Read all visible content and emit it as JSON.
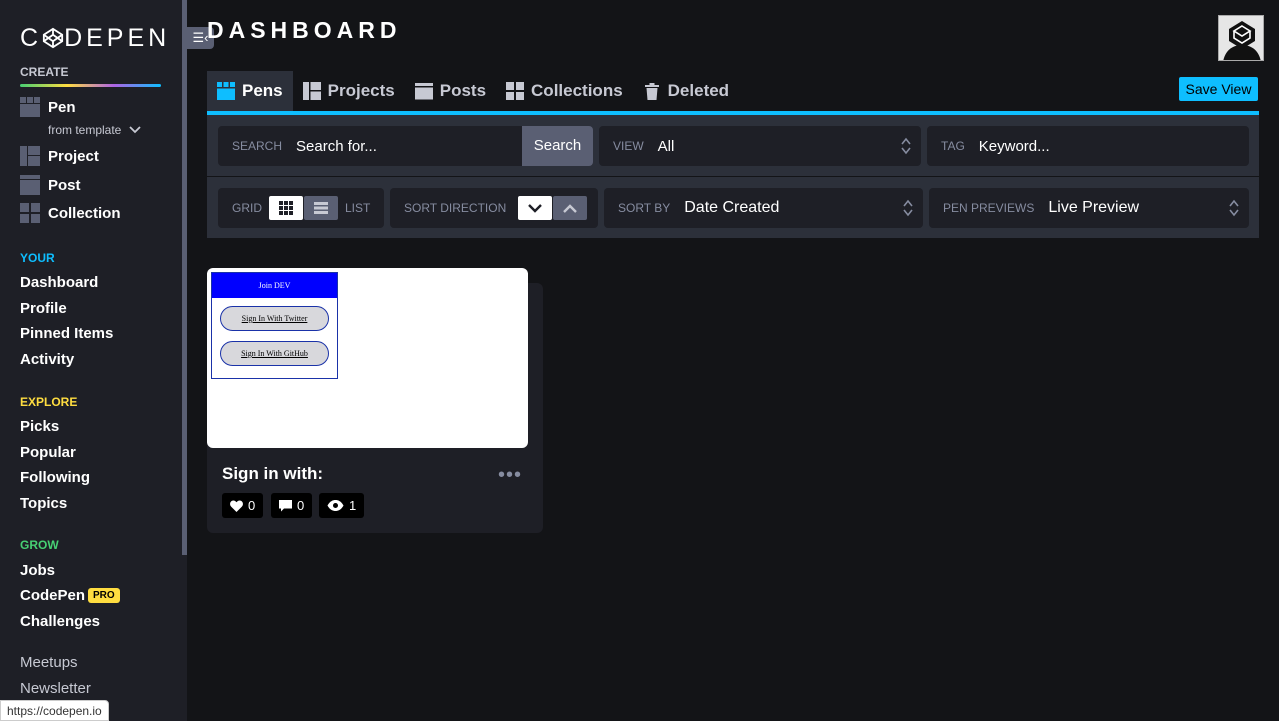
{
  "sidebar": {
    "logo_text": "CODEPEN",
    "create_label": "CREATE",
    "create_items": [
      {
        "label": "Pen",
        "icon": "pen-icon"
      },
      {
        "label": "Project",
        "icon": "project-icon"
      },
      {
        "label": "Post",
        "icon": "post-icon"
      },
      {
        "label": "Collection",
        "icon": "collection-icon"
      }
    ],
    "from_template": "from template",
    "your_label": "YOUR",
    "your_items": [
      "Dashboard",
      "Profile",
      "Pinned Items",
      "Activity"
    ],
    "explore_label": "EXPLORE",
    "explore_items": [
      "Picks",
      "Popular",
      "Following",
      "Topics"
    ],
    "grow_label": "GROW",
    "grow_items": [
      "Jobs",
      "CodePen",
      "Challenges"
    ],
    "pro_badge": "PRO",
    "extra_items": [
      "Meetups",
      "Newsletter"
    ],
    "colors": {
      "your": "#0ebeff",
      "explore": "#ffdd40",
      "grow": "#47cf73"
    }
  },
  "status_url": "https://codepen.io",
  "header": {
    "title": "DASHBOARD",
    "save_view": "Save View"
  },
  "tabs": [
    {
      "label": "Pens",
      "icon": "pens-icon",
      "active": true
    },
    {
      "label": "Projects",
      "icon": "projects-icon"
    },
    {
      "label": "Posts",
      "icon": "posts-icon"
    },
    {
      "label": "Collections",
      "icon": "collections-icon"
    },
    {
      "label": "Deleted",
      "icon": "trash-icon"
    }
  ],
  "filters": {
    "search_label": "SEARCH",
    "search_placeholder": "Search for...",
    "search_button": "Search",
    "view_label": "VIEW",
    "view_value": "All",
    "tag_label": "TAG",
    "tag_placeholder": "Keyword...",
    "grid_label": "GRID",
    "list_label": "LIST",
    "sort_direction_label": "SORT DIRECTION",
    "sort_by_label": "SORT BY",
    "sort_by_value": "Date Created",
    "pen_previews_label": "PEN PREVIEWS",
    "pen_previews_value": "Live Preview"
  },
  "pen_card": {
    "title": "Sign in with:",
    "preview_heading": "Join DEV",
    "preview_buttons": [
      "Sign In With Twitter",
      "Sign In With GitHub"
    ],
    "likes": "0",
    "comments": "0",
    "views": "1"
  },
  "accent_color": "#0ebeff"
}
